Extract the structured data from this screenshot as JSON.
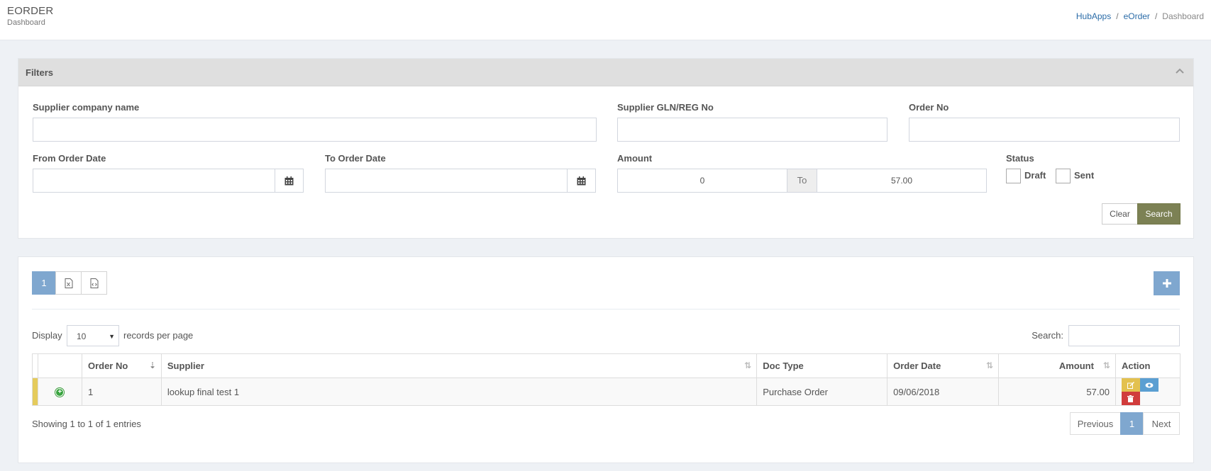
{
  "header": {
    "app_title": "EORDER",
    "app_subtitle": "Dashboard",
    "breadcrumb": [
      {
        "label": "HubApps"
      },
      {
        "label": "eOrder"
      },
      {
        "label": "Dashboard"
      }
    ],
    "breadcrumb_separator": "/"
  },
  "filters": {
    "title": "Filters",
    "supplier_name": {
      "label": "Supplier company name",
      "value": ""
    },
    "supplier_gln": {
      "label": "Supplier GLN/REG No",
      "value": ""
    },
    "order_no": {
      "label": "Order No",
      "value": ""
    },
    "from_date": {
      "label": "From Order Date",
      "value": ""
    },
    "to_date": {
      "label": "To Order Date",
      "value": ""
    },
    "amount": {
      "label": "Amount",
      "from_value": "0",
      "to_label": "To",
      "to_value": "57.00"
    },
    "status": {
      "label": "Status",
      "options": [
        "Draft",
        "Sent"
      ]
    },
    "clear_label": "Clear",
    "search_label": "Search"
  },
  "results": {
    "toolbar": {
      "page_label": "1",
      "excel_icon": "excel-file-icon",
      "code_icon": "code-file-icon",
      "add_icon": "plus-icon"
    },
    "length": {
      "display_label": "Display",
      "value": "10",
      "suffix": "records per page"
    },
    "search_label": "Search:",
    "columns": [
      "Order No",
      "Supplier",
      "Doc Type",
      "Order Date",
      "Amount",
      "Action"
    ],
    "rows": [
      {
        "order_no": "1",
        "supplier": "lookup final test 1",
        "doc_type": "Purchase Order",
        "order_date": "09/06/2018",
        "amount": "57.00"
      }
    ],
    "info": "Showing 1 to 1 of 1 entries",
    "pager": {
      "previous": "Previous",
      "current": "1",
      "next": "Next"
    }
  },
  "colors": {
    "accent_blue": "#7fa7cf",
    "search_green": "#7c8154",
    "row_marker": "#e5cb5c",
    "edit": "#e3c14f",
    "view": "#5b9fd2",
    "delete": "#d13c3c"
  }
}
